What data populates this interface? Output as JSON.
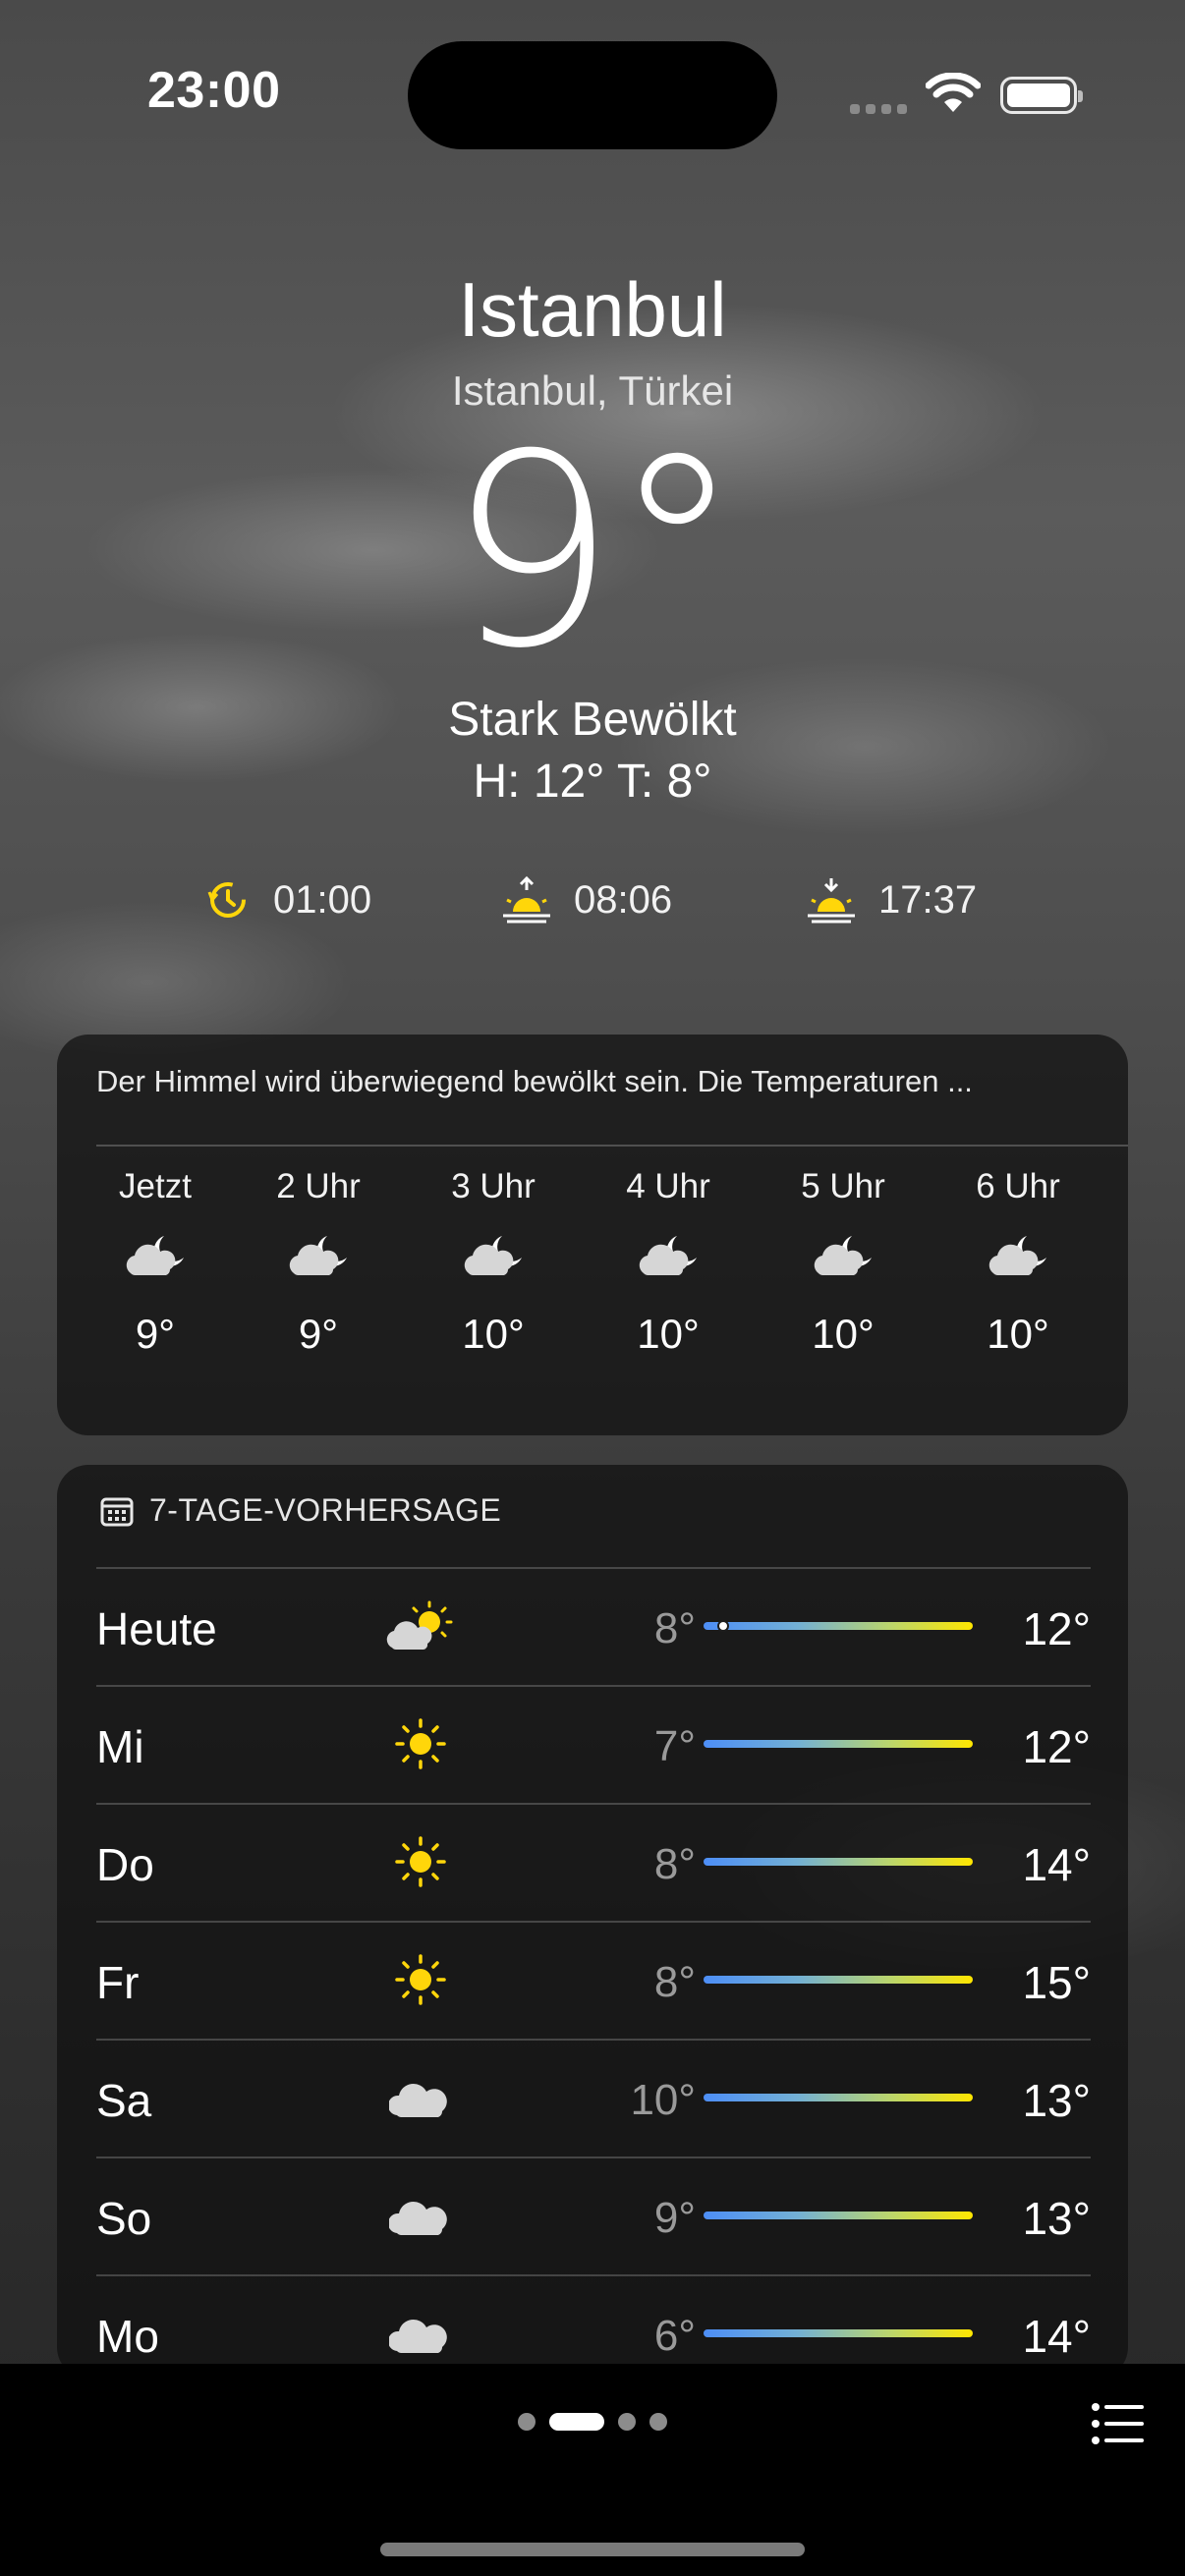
{
  "status": {
    "time": "23:00"
  },
  "location": {
    "city": "Istanbul",
    "region": "Istanbul, Türkei",
    "temperature": "9°",
    "condition": "Stark Bewölkt",
    "hilo": "H: 12° T: 8°"
  },
  "sun_events": [
    {
      "icon": "clock-sun-icon",
      "time": "01:00"
    },
    {
      "icon": "sunrise-icon",
      "time": "08:06"
    },
    {
      "icon": "sunset-icon",
      "time": "17:37"
    }
  ],
  "hourly": {
    "summary": "Der Himmel wird überwiegend bewölkt sein. Die Temperaturen ...",
    "items": [
      {
        "label": "Jetzt",
        "icon": "cloud-moon-icon",
        "temp": "9°"
      },
      {
        "label": "2 Uhr",
        "icon": "cloud-moon-icon",
        "temp": "9°"
      },
      {
        "label": "3 Uhr",
        "icon": "cloud-moon-icon",
        "temp": "10°"
      },
      {
        "label": "4 Uhr",
        "icon": "cloud-moon-icon",
        "temp": "10°"
      },
      {
        "label": "5 Uhr",
        "icon": "cloud-moon-icon",
        "temp": "10°"
      },
      {
        "label": "6 Uhr",
        "icon": "cloud-moon-icon",
        "temp": "10°"
      }
    ]
  },
  "daily": {
    "title": "7-TAGE-VORHERSAGE",
    "days": [
      {
        "name": "Heute",
        "icon": "cloud-sun-icon",
        "low": "8°",
        "high": "12°",
        "current_fraction": 0.07
      },
      {
        "name": "Mi",
        "icon": "sun-icon",
        "low": "7°",
        "high": "12°"
      },
      {
        "name": "Do",
        "icon": "sun-icon",
        "low": "8°",
        "high": "14°"
      },
      {
        "name": "Fr",
        "icon": "sun-icon",
        "low": "8°",
        "high": "15°"
      },
      {
        "name": "Sa",
        "icon": "cloud-icon",
        "low": "10°",
        "high": "13°"
      },
      {
        "name": "So",
        "icon": "cloud-icon",
        "low": "9°",
        "high": "13°"
      },
      {
        "name": "Mo",
        "icon": "cloud-icon",
        "low": "6°",
        "high": "14°"
      }
    ]
  },
  "colors": {
    "sun_yellow": "#FFD60A",
    "bar_cold": "#4D8EF7",
    "bar_warm": "#FFE600"
  },
  "pager": {
    "pages": 4,
    "active": 1
  }
}
